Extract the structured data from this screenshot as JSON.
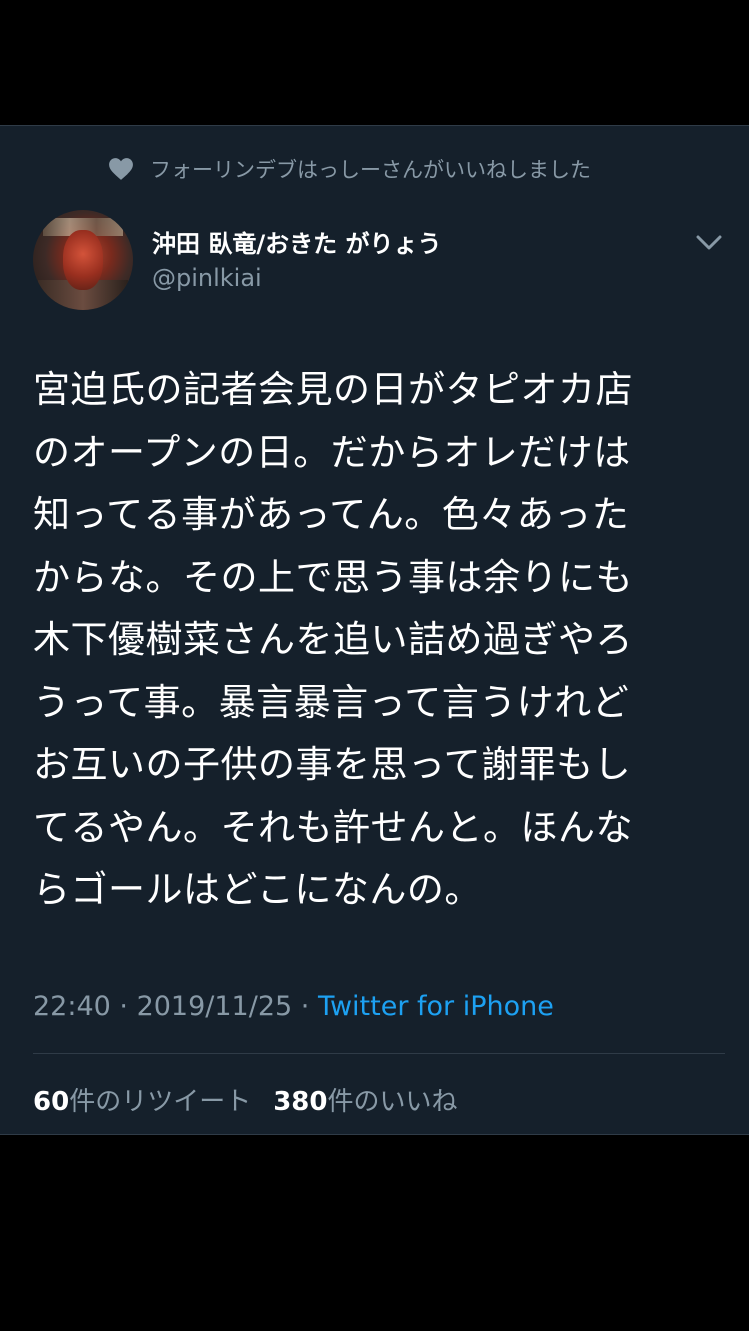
{
  "social_context": {
    "icon": "heart-icon",
    "text": "フォーリンデブはっしーさんがいいねしました"
  },
  "author": {
    "display_name": "沖田 臥竜/おきた がりょう",
    "handle": "@pinlkiai"
  },
  "tweet": {
    "lines": [
      "宮迫氏の記者会見の日がタピオカ店",
      "のオープンの日。だからオレだけは",
      "知ってる事があってん。色々あった",
      "からな。その上で思う事は余りにも",
      "木下優樹菜さんを追い詰め過ぎやろ",
      "うって事。暴言暴言って言うけれど",
      "お互いの子供の事を思って謝罪もし",
      "てるやん。それも許せんと。ほんな",
      "らゴールはどこになんの。"
    ]
  },
  "meta": {
    "time": "22:40",
    "separator": " · ",
    "date": "2019/11/25",
    "source": "Twitter for iPhone"
  },
  "stats": {
    "retweets_count": "60",
    "retweets_label": "件のリツイート",
    "likes_count": "380",
    "likes_label": "件のいいね"
  },
  "colors": {
    "card_background": "#15202b",
    "secondary_text": "#8899a6",
    "link": "#1da1f2"
  }
}
